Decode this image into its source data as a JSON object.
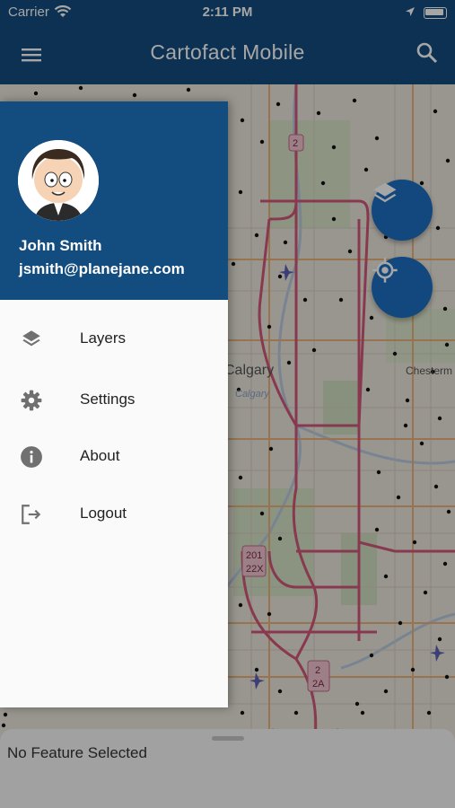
{
  "status_bar": {
    "carrier": "Carrier",
    "time": "2:11 PM"
  },
  "app_bar": {
    "title": "Cartofact Mobile",
    "menu_icon": "hamburger-menu-icon",
    "search_icon": "search-icon"
  },
  "map": {
    "labels": [
      "Calgary",
      "Calgary",
      "Chesterm",
      "2",
      "201",
      "22X",
      "2",
      "2A"
    ],
    "fab_layers_icon": "layers-icon",
    "fab_locate_icon": "my-location-icon"
  },
  "drawer": {
    "user": {
      "name": "John Smith",
      "email": "jsmith@planejane.com"
    },
    "items": [
      {
        "label": "Layers",
        "icon": "layers-icon"
      },
      {
        "label": "Settings",
        "icon": "gear-icon"
      },
      {
        "label": "About",
        "icon": "info-icon"
      },
      {
        "label": "Logout",
        "icon": "logout-icon"
      }
    ]
  },
  "bottom_sheet": {
    "label": "No Feature Selected"
  },
  "colors": {
    "brand": "#134c7e",
    "fab": "#1d6fc1",
    "road_major": "#d2587a"
  }
}
